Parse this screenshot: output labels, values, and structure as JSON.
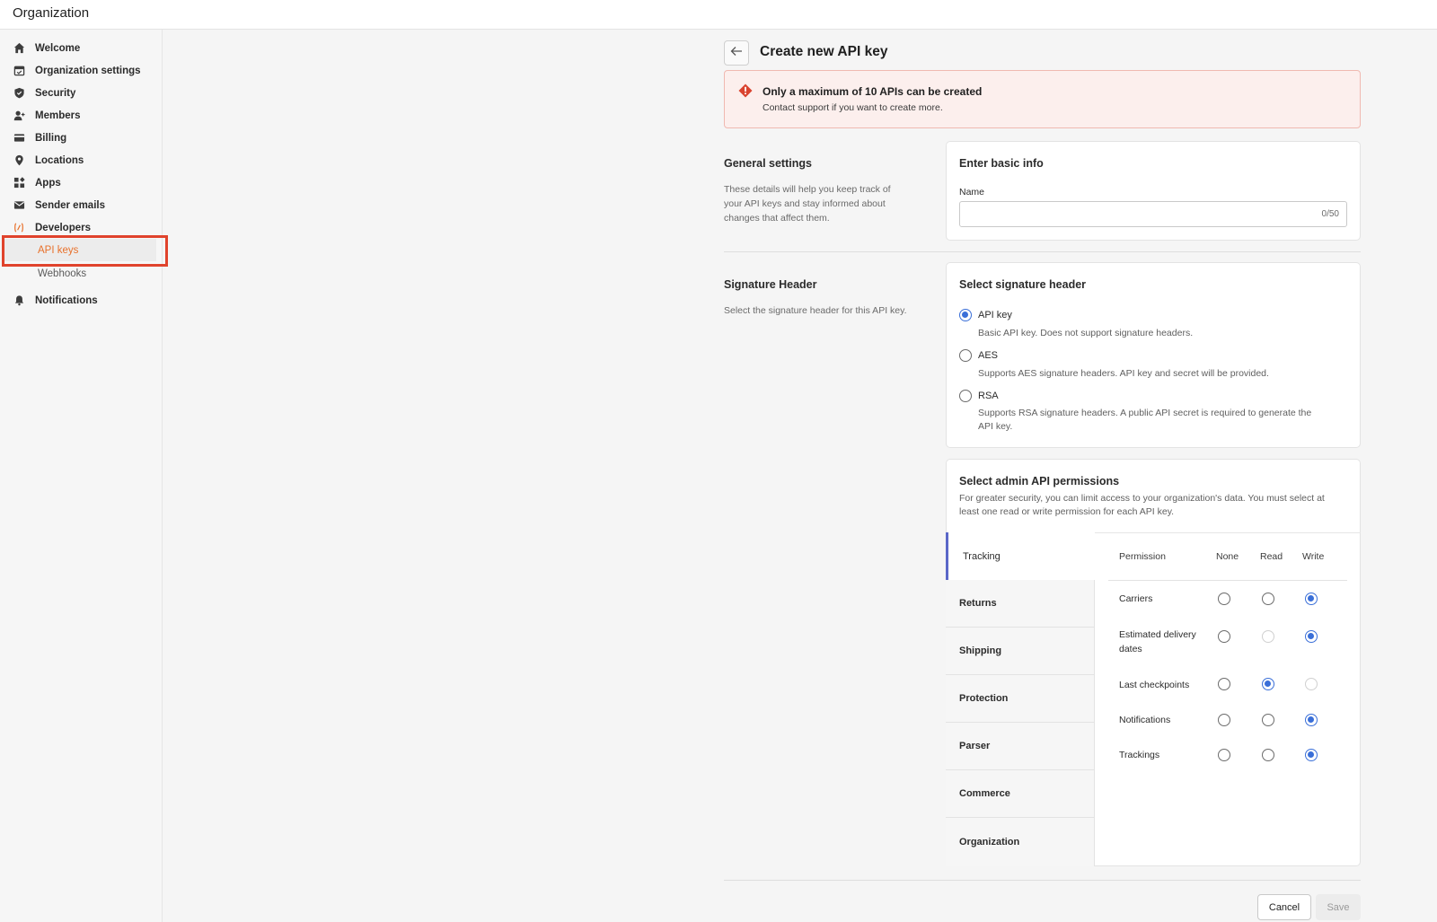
{
  "header": {
    "title": "Organization"
  },
  "sidebar": {
    "items": [
      {
        "label": "Welcome",
        "icon": "home-icon"
      },
      {
        "label": "Organization settings",
        "icon": "calendar-check-icon"
      },
      {
        "label": "Security",
        "icon": "shield-icon"
      },
      {
        "label": "Members",
        "icon": "user-plus-icon"
      },
      {
        "label": "Billing",
        "icon": "credit-card-icon"
      },
      {
        "label": "Locations",
        "icon": "map-pin-icon"
      },
      {
        "label": "Apps",
        "icon": "apps-grid-icon"
      },
      {
        "label": "Sender emails",
        "icon": "envelope-icon"
      },
      {
        "label": "Developers",
        "icon": "code-icon"
      }
    ],
    "sub_items": [
      {
        "label": "API keys",
        "active": true
      },
      {
        "label": "Webhooks",
        "active": false
      }
    ],
    "bottom_item": {
      "label": "Notifications",
      "icon": "bell-icon"
    },
    "accent_color": "#e8702a"
  },
  "page": {
    "title": "Create new API key",
    "alert": {
      "title": "Only a maximum of 10 APIs can be created",
      "body": "Contact support if you want to create more.",
      "color": "#d9432f"
    },
    "general": {
      "title": "General settings",
      "desc": [
        "These details will help you keep track of",
        "your API keys and stay informed about",
        "changes that affect them."
      ],
      "card_title": "Enter basic info",
      "name_label": "Name",
      "name_value": "",
      "name_counter": "0/50"
    },
    "signature": {
      "title": "Signature Header",
      "desc": "Select the signature header for this API key.",
      "card_title": "Select signature header",
      "options": [
        {
          "label": "API key",
          "desc": [
            "Basic API key. Does not support signature headers."
          ],
          "checked": true
        },
        {
          "label": "AES",
          "desc": [
            "Supports AES signature headers. API key and secret will be provided."
          ],
          "checked": false
        },
        {
          "label": "RSA",
          "desc": [
            "Supports RSA signature headers. A public API secret is required to generate the",
            "API key."
          ],
          "checked": false
        }
      ]
    },
    "permissions": {
      "card_title": "Select admin API permissions",
      "desc": [
        "For greater security, you can limit access to your organization's data. You must select at",
        "least one read or write permission for each API key."
      ],
      "tabs": [
        "Tracking",
        "Returns",
        "Shipping",
        "Protection",
        "Parser",
        "Commerce",
        "Organization"
      ],
      "active_tab": "Tracking",
      "columns": [
        "Permission",
        "None",
        "Read",
        "Write"
      ],
      "rows": [
        {
          "name": [
            "Carriers"
          ],
          "selected": "Write",
          "disabled": []
        },
        {
          "name": [
            "Estimated delivery",
            "dates"
          ],
          "selected": "Write",
          "disabled": [
            "Read"
          ]
        },
        {
          "name": [
            "Last checkpoints"
          ],
          "selected": "Read",
          "disabled": [
            "Write"
          ]
        },
        {
          "name": [
            "Notifications"
          ],
          "selected": "Write",
          "disabled": []
        },
        {
          "name": [
            "Trackings"
          ],
          "selected": "Write",
          "disabled": []
        }
      ],
      "accent_color": "#3a6fd8"
    },
    "actions": {
      "cancel": "Cancel",
      "save": "Save"
    }
  }
}
